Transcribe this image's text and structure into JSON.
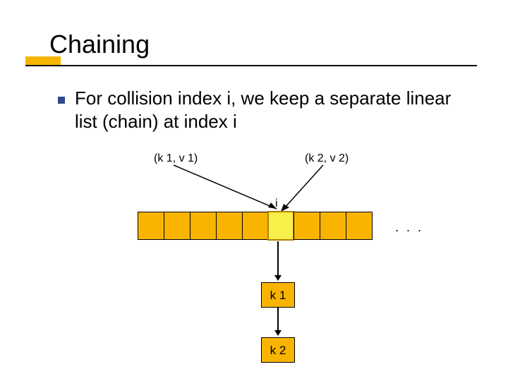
{
  "title": "Chaining",
  "body": "For collision index i, we keep a separate linear list (chain) at index i",
  "kv1": "(k 1, v 1)",
  "kv2": "(k 2, v 2)",
  "index_label": "i",
  "dots": ". . .",
  "chain1": "k 1",
  "chain2": "k 2"
}
